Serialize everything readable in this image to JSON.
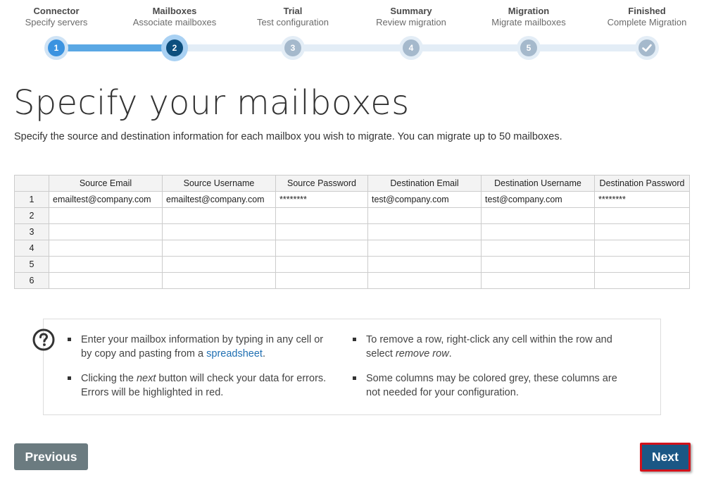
{
  "stepper": {
    "steps": [
      {
        "title": "Connector",
        "subtitle": "Specify servers",
        "number": "1",
        "state": "completed"
      },
      {
        "title": "Mailboxes",
        "subtitle": "Associate mailboxes",
        "number": "2",
        "state": "current"
      },
      {
        "title": "Trial",
        "subtitle": "Test configuration",
        "number": "3",
        "state": "pending"
      },
      {
        "title": "Summary",
        "subtitle": "Review migration",
        "number": "4",
        "state": "pending"
      },
      {
        "title": "Migration",
        "subtitle": "Migrate mailboxes",
        "number": "5",
        "state": "pending"
      },
      {
        "title": "Finished",
        "subtitle": "Complete Migration",
        "icon": "checkmark-icon",
        "state": "pending"
      }
    ]
  },
  "page": {
    "title": "Specify your mailboxes",
    "subtitle": "Specify the source and destination information for each mailbox you wish to migrate. You can migrate up to 50 mailboxes."
  },
  "grid": {
    "columns": [
      "Source Email",
      "Source Username",
      "Source Password",
      "Destination Email",
      "Destination Username",
      "Destination Password"
    ],
    "rows": [
      {
        "num": "1",
        "cells": [
          "emailtest@company.com",
          "emailtest@company.com",
          "********",
          "test@company.com",
          "test@company.com",
          "********"
        ]
      },
      {
        "num": "2",
        "cells": [
          "",
          "",
          "",
          "",
          "",
          ""
        ]
      },
      {
        "num": "3",
        "cells": [
          "",
          "",
          "",
          "",
          "",
          ""
        ]
      },
      {
        "num": "4",
        "cells": [
          "",
          "",
          "",
          "",
          "",
          ""
        ]
      },
      {
        "num": "5",
        "cells": [
          "",
          "",
          "",
          "",
          "",
          ""
        ]
      },
      {
        "num": "6",
        "cells": [
          "",
          "",
          "",
          "",
          "",
          ""
        ]
      }
    ]
  },
  "help": {
    "icon": "question-circle-icon",
    "tip1_a": "Enter your mailbox information by typing in any cell or by copy and pasting from a ",
    "tip1_link": "spreadsheet",
    "tip1_b": ".",
    "tip2_a": "Clicking the ",
    "tip2_em": "next",
    "tip2_b": " button will check your data for errors. Errors will be highlighted in red.",
    "tip3_a": "To remove a row, right-click any cell within the row and select ",
    "tip3_em": "remove row",
    "tip3_b": ".",
    "tip4": "Some columns may be colored grey, these columns are not needed for your configuration."
  },
  "buttons": {
    "previous": "Previous",
    "next": "Next"
  },
  "colors": {
    "accent": "#1b5785",
    "highlight_border": "#d3121b",
    "step_completed": "#3b93e0",
    "step_current": "#0d4f7e",
    "step_pending": "#a5b9cc"
  }
}
